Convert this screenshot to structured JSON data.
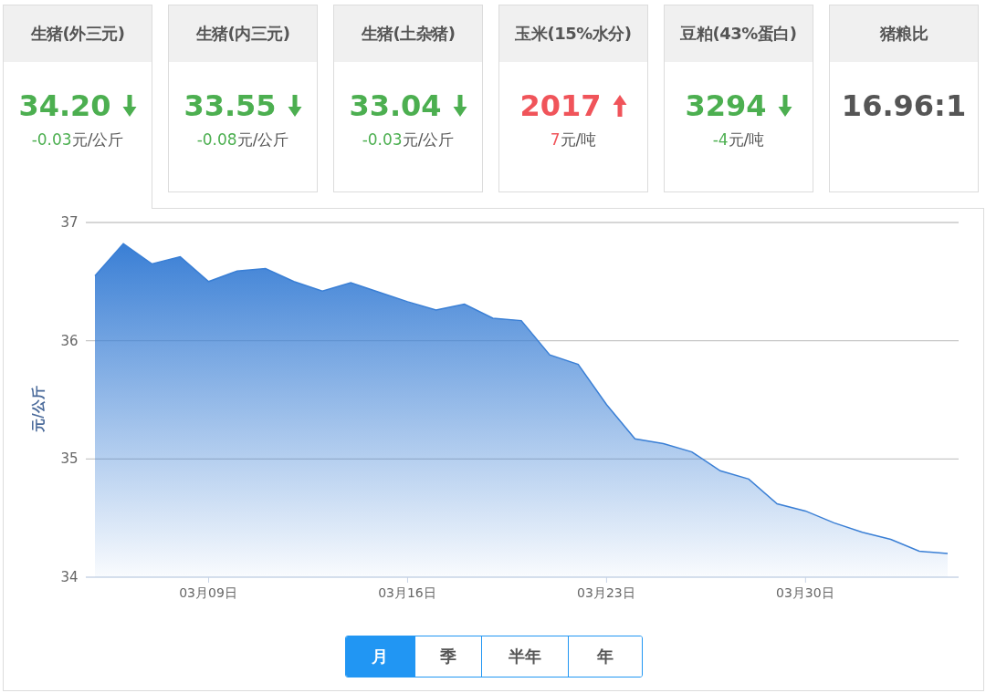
{
  "cards": [
    {
      "title": "生猪(外三元)",
      "value": "34.20",
      "kind": "down",
      "change": "-0.03",
      "unit": "元/公斤",
      "selected": true
    },
    {
      "title": "生猪(内三元)",
      "value": "33.55",
      "kind": "down",
      "change": "-0.08",
      "unit": "元/公斤",
      "selected": false
    },
    {
      "title": "生猪(土杂猪)",
      "value": "33.04",
      "kind": "down",
      "change": "-0.03",
      "unit": "元/公斤",
      "selected": false
    },
    {
      "title": "玉米(15%水分)",
      "value": "2017",
      "kind": "up",
      "change": "7",
      "unit": "元/吨",
      "selected": false
    },
    {
      "title": "豆粕(43%蛋白)",
      "value": "3294",
      "kind": "down",
      "change": "-4",
      "unit": "元/吨",
      "selected": false
    },
    {
      "title": "猪粮比",
      "value": "16.96:1",
      "kind": "flat",
      "selected": false
    }
  ],
  "chart": {
    "chart_data": {
      "type": "area",
      "ylabel": "元/公斤",
      "categories": [
        null,
        null,
        null,
        null,
        "03月09日",
        null,
        null,
        null,
        null,
        null,
        null,
        "03月16日",
        null,
        null,
        null,
        null,
        null,
        null,
        "03月23日",
        null,
        null,
        null,
        null,
        null,
        null,
        "03月30日",
        null,
        null,
        null,
        null,
        null
      ],
      "series": [
        {
          "color": "#3a7fd5",
          "values": [
            36.55,
            36.82,
            36.65,
            36.71,
            36.5,
            36.59,
            36.61,
            36.5,
            36.42,
            36.49,
            36.41,
            36.33,
            36.26,
            36.31,
            36.19,
            36.17,
            35.88,
            35.8,
            35.46,
            35.17,
            35.13,
            35.06,
            34.9,
            34.83,
            34.62,
            34.56,
            34.46,
            34.38,
            34.32,
            34.22,
            34.2
          ]
        }
      ],
      "ylim": [
        34,
        37
      ],
      "yticks": [
        {
          "value": 34,
          "label": "34"
        },
        {
          "value": 35,
          "label": "35"
        },
        {
          "value": 36,
          "label": "36"
        },
        {
          "value": 37,
          "label": "37"
        }
      ]
    }
  },
  "ranges": [
    {
      "label": "月",
      "selected": true
    },
    {
      "label": "季",
      "selected": false
    },
    {
      "label": "半年",
      "selected": false
    },
    {
      "label": "年",
      "selected": false
    }
  ]
}
